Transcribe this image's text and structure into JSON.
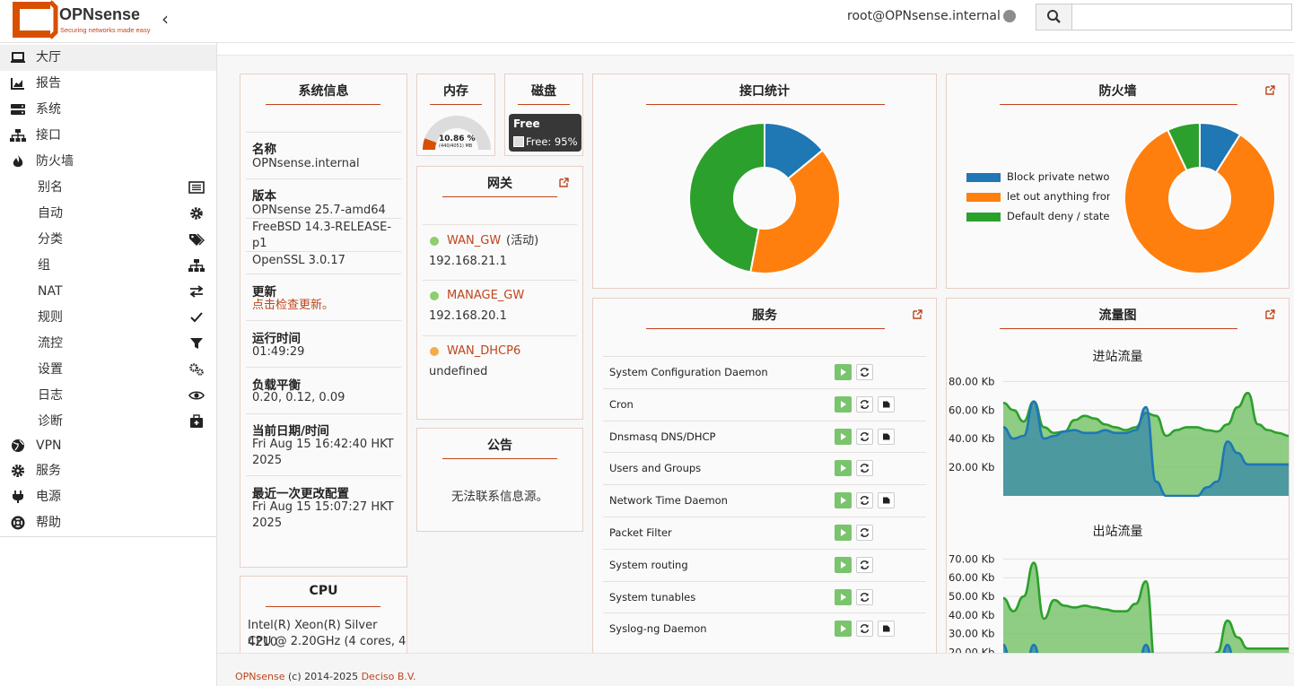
{
  "header": {
    "logo_text": "OPNsense",
    "logo_tagline": "Securing networks made easy",
    "user": "root@OPNsense.internal",
    "search_placeholder": ""
  },
  "sidebar": {
    "items": [
      {
        "label": "大厅",
        "icon": "laptop-icon",
        "active": true
      },
      {
        "label": "报告",
        "icon": "chart-icon"
      },
      {
        "label": "系统",
        "icon": "server-icon"
      },
      {
        "label": "接口",
        "icon": "sitemap-icon"
      },
      {
        "label": "防火墙",
        "icon": "fire-icon"
      }
    ],
    "firewall_sub": [
      {
        "label": "别名",
        "icon": "list-icon"
      },
      {
        "label": "自动",
        "icon": "gear-icon"
      },
      {
        "label": "分类",
        "icon": "tags-icon"
      },
      {
        "label": "组",
        "icon": "sitemap-icon"
      },
      {
        "label": "NAT",
        "icon": "exchange-icon"
      },
      {
        "label": "规则",
        "icon": "check-icon"
      },
      {
        "label": "流控",
        "icon": "filter-icon"
      },
      {
        "label": "设置",
        "icon": "gears-icon"
      },
      {
        "label": "日志",
        "icon": "eye-icon"
      },
      {
        "label": "诊断",
        "icon": "medkit-icon"
      }
    ],
    "bottom_items": [
      {
        "label": "VPN",
        "icon": "globe-icon"
      },
      {
        "label": "服务",
        "icon": "gear-icon"
      },
      {
        "label": "电源",
        "icon": "plug-icon"
      },
      {
        "label": "帮助",
        "icon": "lifebuoy-icon"
      }
    ]
  },
  "sysinfo": {
    "title": "系统信息",
    "name_label": "名称",
    "name_value": "OPNsense.internal",
    "version_label": "版本",
    "version_lines": [
      "OPNsense 25.7-amd64",
      "FreeBSD 14.3-RELEASE-",
      "p1",
      "OpenSSL 3.0.17"
    ],
    "updates_label": "更新",
    "updates_link": "点击检查更新。",
    "uptime_label": "运行时间",
    "uptime_value": "01:49:29",
    "load_label": "负载平衡",
    "load_value": "0.20, 0.12, 0.09",
    "datetime_label": "当前日期/时间",
    "datetime_lines": [
      "Fri Aug 15 16:42:40 HKT",
      "2025"
    ],
    "lastconfig_label": "最近一次更改配置",
    "lastconfig_lines": [
      "Fri Aug 15 15:07:27 HKT",
      "2025"
    ]
  },
  "cpu": {
    "title": "CPU",
    "lines": [
      "Intel(R) Xeon(R) Silver 4210",
      "CPU @ 2.20GHz (4 cores, 4"
    ]
  },
  "memory": {
    "title": "内存",
    "percent_label": "10.86 %",
    "detail": "(440/4051) MB",
    "used_fraction": 0.1086
  },
  "disk": {
    "title": "磁盘",
    "tooltip_title": "Free",
    "tooltip_value": "Free: 95%"
  },
  "gateways": {
    "title": "网关",
    "items": [
      {
        "name": "WAN_GW",
        "status": "(活动)",
        "address": "192.168.21.1",
        "color": "#8fce6f"
      },
      {
        "name": "MANAGE_GW",
        "status": "",
        "address": "192.168.20.1",
        "color": "#8fce6f"
      },
      {
        "name": "WAN_DHCP6",
        "status": "",
        "address": "undefined",
        "color": "#f0ad4e"
      }
    ]
  },
  "announcements": {
    "title": "公告",
    "message": "无法联系信息源。"
  },
  "interfaces": {
    "title": "接口统计"
  },
  "firewall": {
    "title": "防火墙",
    "legend": [
      {
        "label": "Block private networks",
        "color": "#1f77b4"
      },
      {
        "label": "let out anything from fir",
        "color": "#ff7f0e"
      },
      {
        "label": "Default deny / state viol",
        "color": "#2ca02c"
      }
    ]
  },
  "services": {
    "title": "服务",
    "items": [
      {
        "name": "System Configuration Daemon",
        "stop": false
      },
      {
        "name": "Cron",
        "stop": true
      },
      {
        "name": "Dnsmasq DNS/DHCP",
        "stop": true
      },
      {
        "name": "Users and Groups",
        "stop": false
      },
      {
        "name": "Network Time Daemon",
        "stop": true
      },
      {
        "name": "Packet Filter",
        "stop": false
      },
      {
        "name": "System routing",
        "stop": false
      },
      {
        "name": "System tunables",
        "stop": false
      },
      {
        "name": "Syslog-ng Daemon",
        "stop": true
      }
    ]
  },
  "traffic": {
    "title": "流量图",
    "in_title": "进站流量",
    "out_title": "出站流量",
    "in_ticks": [
      "80.00 Kb",
      "60.00 Kb",
      "40.00 Kb",
      "20.00 Kb"
    ],
    "out_ticks": [
      "70.00 Kb",
      "60.00 Kb",
      "50.00 Kb",
      "40.00 Kb",
      "30.00 Kb",
      "20.00 Kb",
      "10.00 Kb"
    ]
  },
  "chart_data": [
    {
      "type": "pie",
      "title": "接口统计",
      "values": [
        14,
        39,
        47
      ],
      "colors": [
        "#1f77b4",
        "#ff7f0e",
        "#2ca02c"
      ]
    },
    {
      "type": "pie",
      "title": "防火墙",
      "categories": [
        "Block private networks",
        "let out anything from fir",
        "Default deny / state viol"
      ],
      "values": [
        9,
        84,
        7
      ],
      "colors": [
        "#1f77b4",
        "#ff7f0e",
        "#2ca02c"
      ]
    },
    {
      "type": "area",
      "title": "进站流量",
      "ylim": [
        0,
        84
      ],
      "x": [
        0,
        1,
        2,
        3,
        4,
        5,
        6,
        7,
        8,
        9,
        10,
        11,
        12,
        13,
        14,
        15,
        16,
        17,
        18,
        19,
        20,
        21,
        22,
        23,
        24,
        25,
        26,
        27,
        28
      ],
      "series": [
        {
          "color": "#2ca02c",
          "values": [
            65,
            60,
            52,
            66,
            48,
            44,
            45,
            53,
            56,
            54,
            50,
            48,
            46,
            48,
            58,
            56,
            42,
            46,
            48,
            48,
            46,
            45,
            50,
            62,
            72,
            50,
            46,
            44,
            42
          ]
        },
        {
          "color": "#1f77b4",
          "values": [
            48,
            40,
            42,
            66,
            40,
            42,
            45,
            46,
            44,
            44,
            46,
            44,
            44,
            46,
            62,
            10,
            0,
            0,
            0,
            0,
            6,
            10,
            38,
            30,
            22,
            22,
            22,
            22,
            22
          ]
        }
      ]
    },
    {
      "type": "area",
      "title": "出站流量",
      "ylim": [
        0,
        75
      ],
      "x": [
        0,
        1,
        2,
        3,
        4,
        5,
        6,
        7,
        8,
        9,
        10,
        11,
        12,
        13,
        14,
        15,
        16,
        17,
        18,
        19,
        20,
        21,
        22,
        23,
        24,
        25,
        26,
        27,
        28
      ],
      "series": [
        {
          "color": "#2ca02c",
          "values": [
            49,
            42,
            50,
            68,
            38,
            48,
            45,
            44,
            45,
            44,
            43,
            42,
            42,
            46,
            58,
            10,
            0,
            0,
            0,
            0,
            8,
            20,
            37,
            28,
            22,
            22,
            22,
            22,
            22
          ]
        },
        {
          "color": "#1f77b4",
          "values": [
            24,
            5,
            5,
            24,
            5,
            5,
            5,
            5,
            5,
            5,
            5,
            5,
            5,
            5,
            24,
            5,
            0,
            0,
            0,
            0,
            0,
            5,
            24,
            5,
            0,
            0,
            0,
            0,
            0
          ]
        }
      ]
    }
  ],
  "footer": {
    "brand": "OPNsense",
    "copyright": " (c) 2014-2025 ",
    "company": "Deciso B.V."
  }
}
